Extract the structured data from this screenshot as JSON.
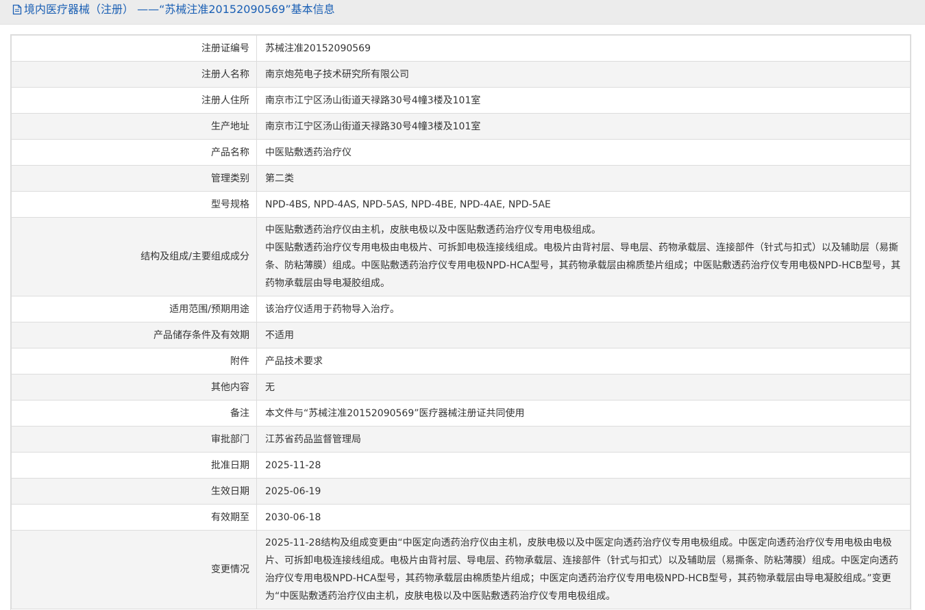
{
  "header": {
    "icon": "document-icon",
    "title": "境内医疗器械（注册） ——“苏械注准20152090569”基本信息"
  },
  "rows": [
    {
      "label": "注册证编号",
      "value": "苏械注准20152090569"
    },
    {
      "label": "注册人名称",
      "value": "南京炮苑电子技术研究所有限公司"
    },
    {
      "label": "注册人住所",
      "value": "南京市江宁区汤山街道天禄路30号4幢3楼及101室"
    },
    {
      "label": "生产地址",
      "value": "南京市江宁区汤山街道天禄路30号4幢3楼及101室"
    },
    {
      "label": "产品名称",
      "value": "中医贴敷透药治疗仪"
    },
    {
      "label": "管理类别",
      "value": "第二类"
    },
    {
      "label": "型号规格",
      "value": "NPD-4BS, NPD-4AS, NPD-5AS, NPD-4BE, NPD-4AE, NPD-5AE"
    },
    {
      "label": "结构及组成/主要组成成分",
      "value": "中医贴敷透药治疗仪由主机，皮肤电极以及中医贴敷透药治疗仪专用电极组成。\n中医贴敷透药治疗仪专用电极由电极片、可拆卸电极连接线组成。电极片由背衬层、导电层、药物承载层、连接部件（针式与扣式）以及辅助层（易撕条、防粘薄膜）组成。中医贴敷透药治疗仪专用电极NPD-HCA型号，其药物承载层由棉质垫片组成；中医贴敷透药治疗仪专用电极NPD-HCB型号，其药物承载层由导电凝胶组成。"
    },
    {
      "label": "适用范围/预期用途",
      "value": "该治疗仪适用于药物导入治疗。"
    },
    {
      "label": "产品储存条件及有效期",
      "value": "不适用"
    },
    {
      "label": "附件",
      "value": "产品技术要求"
    },
    {
      "label": "其他内容",
      "value": "无"
    },
    {
      "label": "备注",
      "value": "本文件与“苏械注准20152090569”医疗器械注册证共同使用"
    },
    {
      "label": "审批部门",
      "value": "江苏省药品监督管理局"
    },
    {
      "label": "批准日期",
      "value": "2025-11-28"
    },
    {
      "label": "生效日期",
      "value": "2025-06-19"
    },
    {
      "label": "有效期至",
      "value": "2030-06-18"
    },
    {
      "label": "变更情况",
      "value": "2025-11-28结构及组成变更由“中医定向透药治疗仪由主机，皮肤电极以及中医定向透药治疗仪专用电极组成。中医定向透药治疗仪专用电极由电极片、可拆卸电极连接线组成。电极片由背衬层、导电层、药物承载层、连接部件（针式与扣式）以及辅助层（易撕条、防粘薄膜）组成。中医定向透药治疗仪专用电极NPD-HCA型号，其药物承载层由棉质垫片组成；中医定向透药治疗仪专用电极NPD-HCB型号，其药物承载层由导电凝胶组成。”变更为“中医贴敷透药治疗仪由主机，皮肤电极以及中医贴敷透药治疗仪专用电极组成。"
    }
  ]
}
